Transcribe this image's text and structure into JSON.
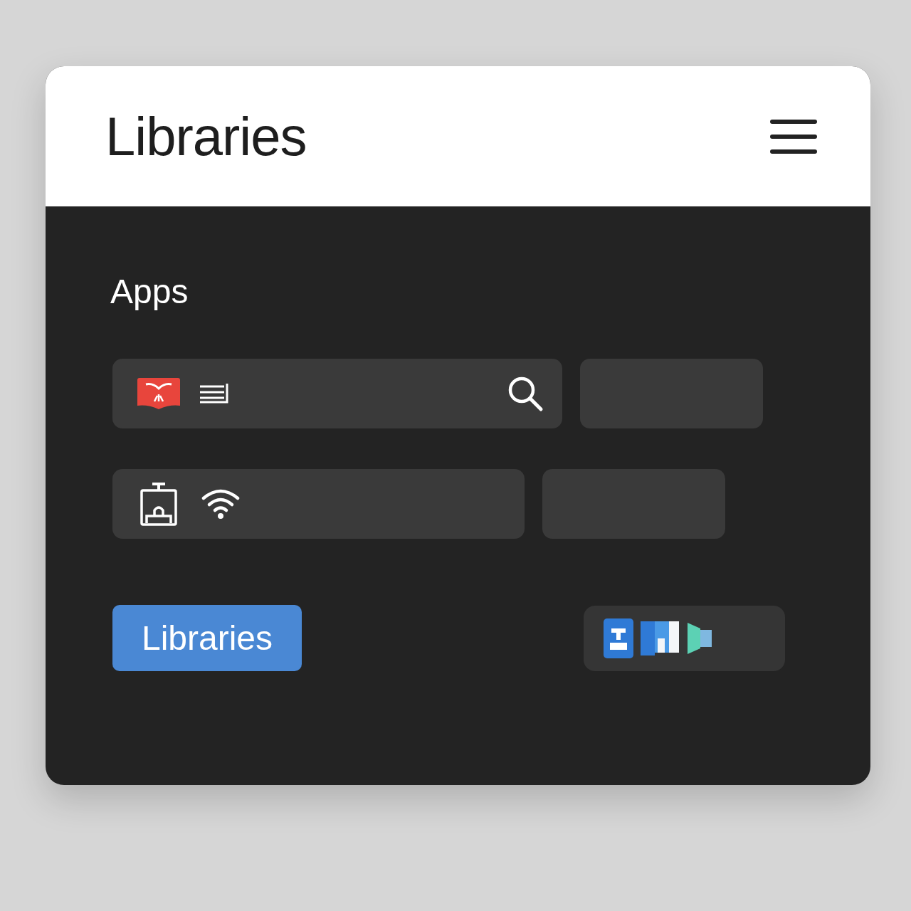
{
  "header": {
    "title": "Libraries"
  },
  "section": {
    "title": "Apps"
  },
  "button": {
    "label": "Libraries"
  }
}
